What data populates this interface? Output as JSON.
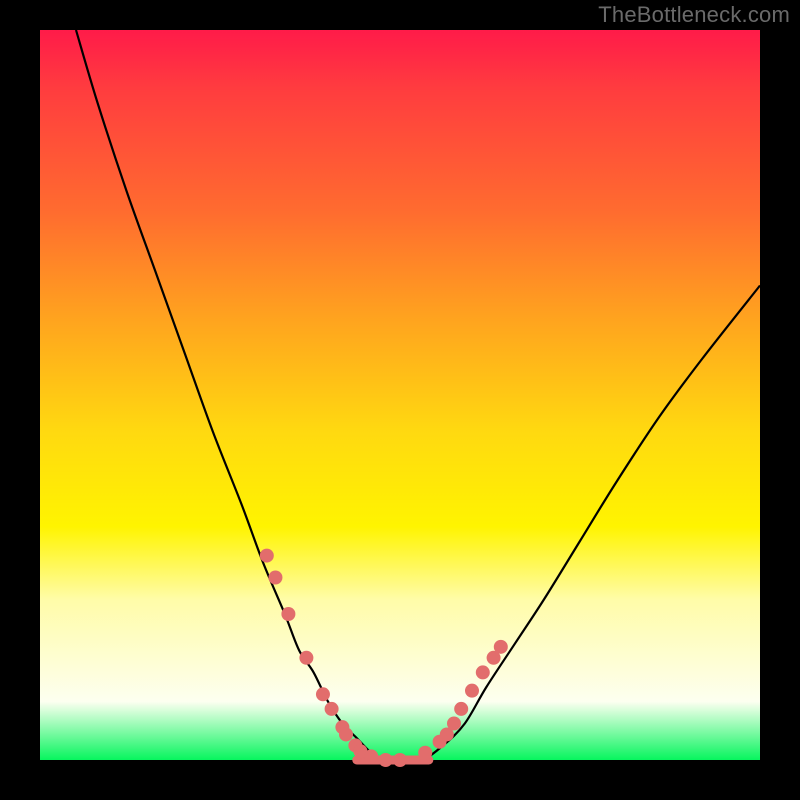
{
  "watermark": "TheBottleneck.com",
  "chart_data": {
    "type": "line",
    "title": "",
    "xlabel": "",
    "ylabel": "",
    "xlim": [
      0,
      100
    ],
    "ylim": [
      0,
      100
    ],
    "series": [
      {
        "name": "curve",
        "x": [
          5,
          8,
          12,
          16,
          20,
          24,
          28,
          31,
          34,
          36,
          38,
          40,
          42,
          44,
          46,
          48,
          50,
          53,
          56,
          59,
          62,
          66,
          70,
          75,
          80,
          86,
          92,
          100
        ],
        "y": [
          100,
          90,
          78,
          67,
          56,
          45,
          35,
          27,
          20,
          15,
          12,
          8,
          5,
          3,
          1,
          0,
          0,
          0,
          2,
          5,
          10,
          16,
          22,
          30,
          38,
          47,
          55,
          65
        ]
      }
    ],
    "markers": {
      "name": "marker-dots",
      "x": [
        31.5,
        32.7,
        34.5,
        37.0,
        39.3,
        40.5,
        42.0,
        42.5,
        43.8,
        44.5,
        46.0,
        48.0,
        50.0,
        53.5,
        55.5,
        56.5,
        57.5,
        58.5,
        60.0,
        61.5,
        63.0,
        64.0
      ],
      "y": [
        28,
        25,
        20,
        14,
        9,
        7,
        4.5,
        3.5,
        2,
        1.2,
        0.5,
        0,
        0,
        1,
        2.5,
        3.5,
        5,
        7,
        9.5,
        12,
        14,
        15.5
      ],
      "color": "#e26d6c",
      "radius": 7
    },
    "bottom_line": {
      "name": "baseline",
      "y": 0,
      "x_start": 44,
      "x_end": 54,
      "color": "#e26d6c",
      "thickness": 9
    },
    "colors": {
      "curve": "#000000",
      "background_gradient": [
        "#ff1b49",
        "#ff6c2f",
        "#ffd910",
        "#fffca8",
        "#07f55e"
      ],
      "frame": "#000000"
    }
  }
}
